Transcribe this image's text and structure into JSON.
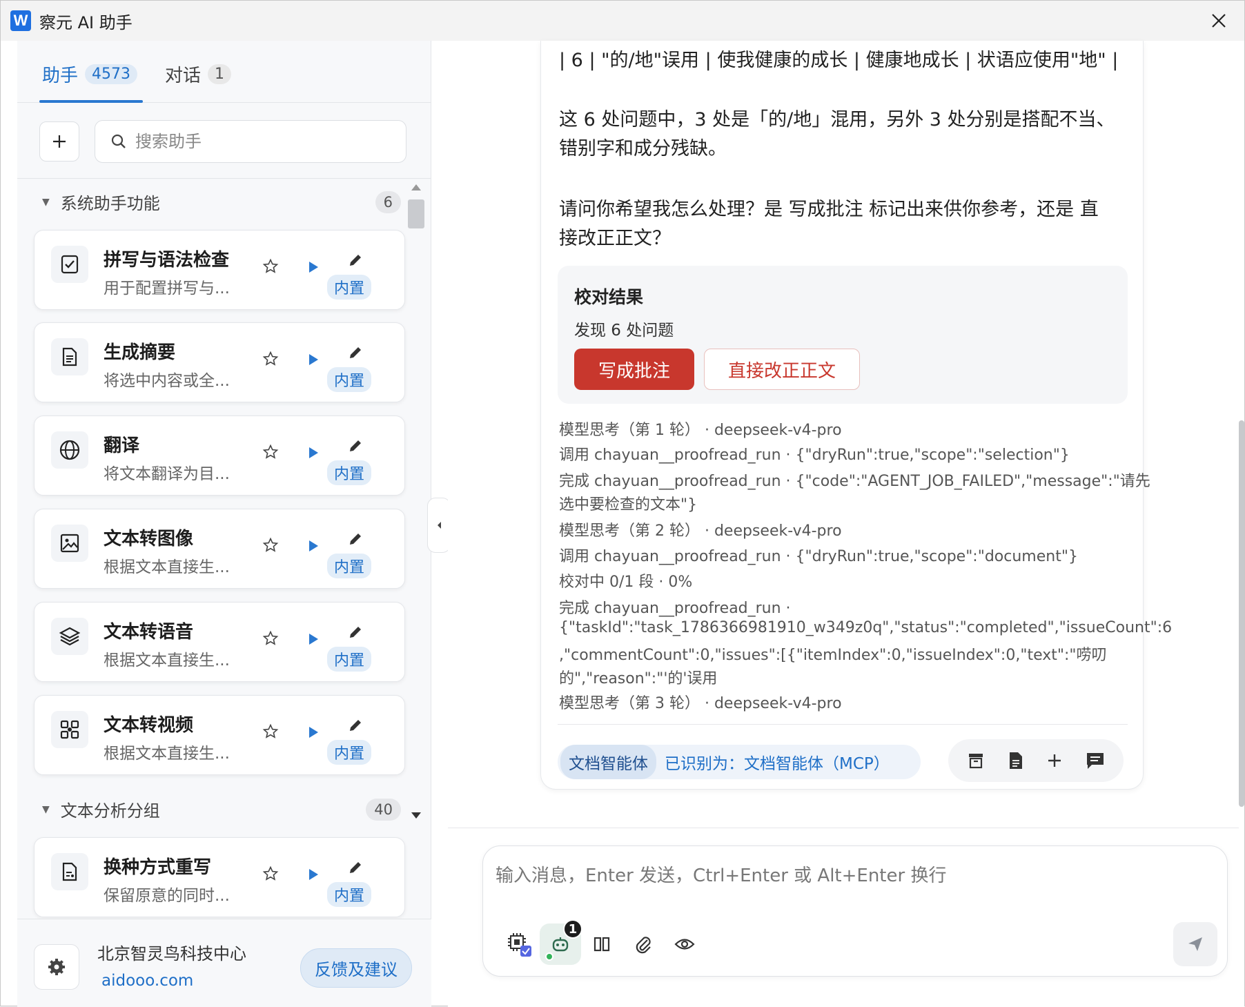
{
  "window": {
    "logo": "W",
    "title": "察元 AI 助手"
  },
  "left": {
    "tabs": [
      {
        "label": "助手",
        "count": "4573"
      },
      {
        "label": "对话",
        "count": "1"
      }
    ],
    "search": {
      "placeholder": "搜索助手"
    },
    "groups": [
      {
        "label": "系统助手功能",
        "count": "6"
      },
      {
        "label": "文本分析分组",
        "count": "40"
      }
    ],
    "cards": [
      {
        "name": "拼写与语法检查",
        "desc": "用于配置拼写与...",
        "badge": "内置",
        "icon": "check-doc-icon"
      },
      {
        "name": "生成摘要",
        "desc": "将选中内容或全...",
        "badge": "内置",
        "icon": "document-icon"
      },
      {
        "name": "翻译",
        "desc": "将文本翻译为目...",
        "badge": "内置",
        "icon": "globe-icon"
      },
      {
        "name": "文本转图像",
        "desc": "根据文本直接生...",
        "badge": "内置",
        "icon": "image-icon"
      },
      {
        "name": "文本转语音",
        "desc": "根据文本直接生...",
        "badge": "内置",
        "icon": "layers-icon"
      },
      {
        "name": "文本转视频",
        "desc": "根据文本直接生...",
        "badge": "内置",
        "icon": "grid-icon"
      },
      {
        "name": "换种方式重写",
        "desc": "保留原意的同时...",
        "badge": "内置",
        "icon": "rewrite-doc-icon"
      }
    ],
    "footer": {
      "org": "北京智灵鸟科技中心",
      "link": "aidooo.com",
      "feedback": "反馈及建议"
    }
  },
  "message": {
    "table_row": "| 6 | \"的/地\"误用 | 使我健康的成长 | 健康地成长 | 状语应使用\"地\" |",
    "para1_line1": "这 6 处问题中，3 处是「的/地」混用，另外 3 处分别是搭配不当、",
    "para1_line2": "错别字和成分残缺。",
    "para2_line1": "请问你希望我怎么处理？是 写成批注 标记出来供你参考，还是 直",
    "para2_line2": "接改正正文？",
    "result": {
      "title": "校对结果",
      "subtitle": "发现 6 处问题",
      "primary": "写成批注",
      "secondary": "直接改正正文"
    },
    "logs": [
      "模型思考（第 1 轮） · deepseek-v4-pro",
      "调用 chayuan__proofread_run · {\"dryRun\":true,\"scope\":\"selection\"}",
      "完成 chayuan__proofread_run · {\"code\":\"AGENT_JOB_FAILED\",\"message\":\"请先",
      "选中要检查的文本\"}",
      "模型思考（第 2 轮） · deepseek-v4-pro",
      "调用 chayuan__proofread_run · {\"dryRun\":true,\"scope\":\"document\"}",
      "校对中 0/1 段 · 0%",
      "完成 chayuan__proofread_run ·",
      "{\"taskId\":\"task_1786366981910_w349z0q\",\"status\":\"completed\",\"issueCount\":6",
      ",\"commentCount\":0,\"issues\":[{\"itemIndex\":0,\"issueIndex\":0,\"text\":\"唠叨",
      "的\",\"reason\":\"'的'误用",
      "模型思考（第 3 轮） · deepseek-v4-pro"
    ],
    "agent_tag": "文档智能体",
    "agent_text": "已识别为：文档智能体（MCP）"
  },
  "composer": {
    "placeholder": "输入消息，Enter 发送，Ctrl+Enter 或 Alt+Enter 换行",
    "agent_badge": "1"
  },
  "colors": {
    "accent": "#1f6fc7",
    "danger": "#c8372d"
  }
}
